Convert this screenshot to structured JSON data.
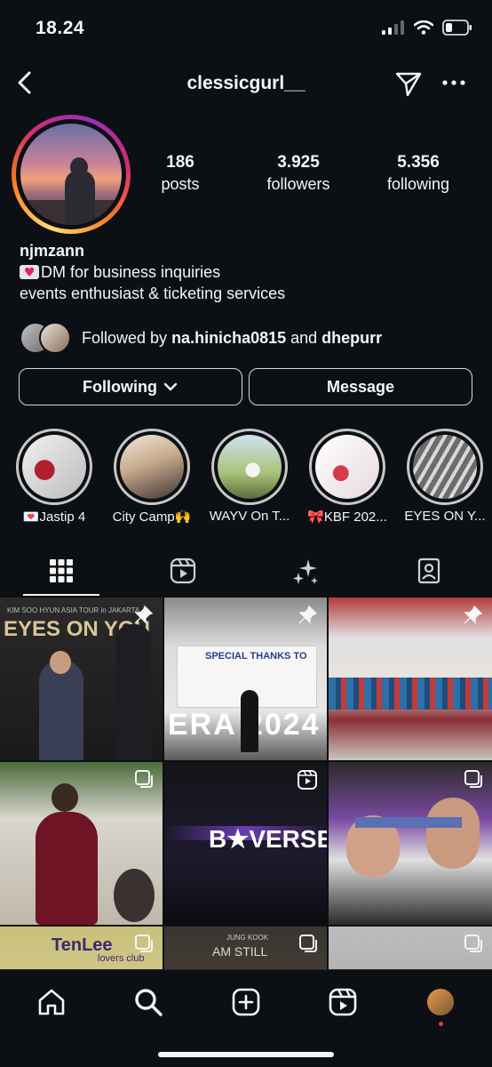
{
  "status_bar": {
    "time": "18.24"
  },
  "header": {
    "username": "clessicgurl__"
  },
  "profile": {
    "display_name": "njmzann",
    "bio_line1": "DM for business inquiries",
    "bio_line2": "events enthusiast & ticketing services",
    "stats": [
      {
        "value": "186",
        "label": "posts"
      },
      {
        "value": "3.925",
        "label": "followers"
      },
      {
        "value": "5.356",
        "label": "following"
      }
    ]
  },
  "followed_by": {
    "prefix": "Followed by ",
    "user1": "na.hinicha0815",
    "joiner": " and ",
    "user2": "dhepurr"
  },
  "buttons": {
    "following": "Following",
    "message": "Message"
  },
  "highlights": [
    {
      "label": "💌Jastip 4"
    },
    {
      "label": "City Camp🙌"
    },
    {
      "label": "WAYV On T..."
    },
    {
      "label": "🎀KBF 202..."
    },
    {
      "label": "EYES ON Y..."
    }
  ],
  "grid_posts": [
    {
      "text": "EYES ON YOU",
      "sub": "KIM SOO HYUN ASIA TOUR in JAKARTA",
      "pinned": true
    },
    {
      "text": "SPECIAL THANKS TO",
      "sub": "ERA 2024",
      "pinned": true
    },
    {
      "text": "",
      "sub": "",
      "pinned": true
    },
    {
      "text": "",
      "sub": "",
      "type": "carousel"
    },
    {
      "text": "B★VERSE",
      "sub": "",
      "type": "reel"
    },
    {
      "text": "",
      "sub": "",
      "type": "carousel"
    },
    {
      "text": "TenLee",
      "sub": "lovers club",
      "type": "carousel"
    },
    {
      "text": "AM STILL",
      "sub": "JUNG KOOK",
      "type": "carousel"
    },
    {
      "text": "",
      "sub": "",
      "type": "carousel"
    }
  ],
  "colors": {
    "background": "#0c1014",
    "text": "#f5f5f5",
    "border": "#dbdbdb",
    "notification": "#ff3040"
  }
}
